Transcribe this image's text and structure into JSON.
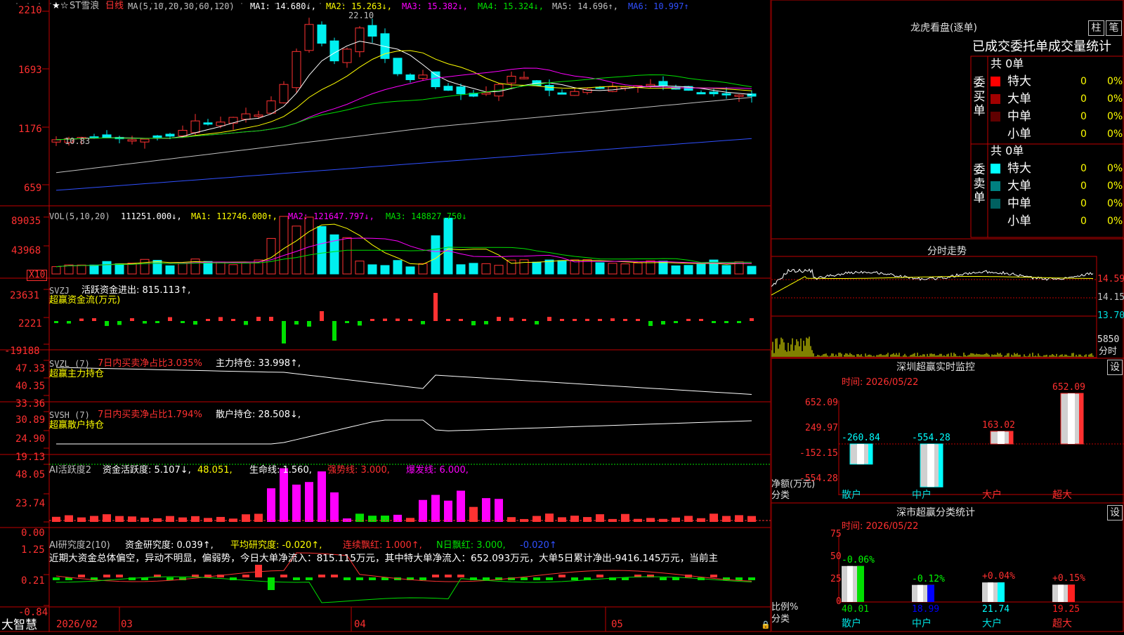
{
  "colors": {
    "up": "#ff3232",
    "down": "#00f0f0",
    "ma1": "#ffffff",
    "ma2": "#ffff00",
    "ma3": "#ff00ff",
    "ma4": "#00e000",
    "ma5": "#c0c0c0",
    "ma6": "#3050ff",
    "frame": "#c00000",
    "label": "#ff4040",
    "text": "#c0c0c0"
  },
  "panels": {
    "kline": {
      "star_icon": "★",
      "star_icon2": "☆",
      "stock_name": "ST雪浪",
      "period": "日线",
      "ma_params": "MA(5,10,20,30,60,120)",
      "ma1_text": "MA1: 14.680↓,",
      "ma2_text": "MA2: 15.263↓,",
      "ma3_text": "MA3: 15.382↓,",
      "ma4_text": "MA4: 15.324↓,",
      "ma5_text": "MA5: 14.696↑,",
      "ma6_text": "MA6: 10.997↑",
      "y_ticks": [
        "2210",
        "1693",
        "1176",
        "659"
      ],
      "high_marker": "22.10",
      "low_marker": "10.83",
      "price_top": 22.4,
      "price_bottom": 5.8
    },
    "vol": {
      "title": "VOL(5,10,20)",
      "value": "111251.000↓,",
      "ma1": "MA1: 112746.000↑,",
      "ma2": "MA2: 121647.797↓,",
      "ma3": "MA3: 148827.750↓",
      "y_ticks": [
        "89035",
        "43968"
      ],
      "unit": "X10"
    },
    "svzj": {
      "title": "SVZJ",
      "line1": "活跃资金进出: 815.113↑,",
      "line2": "超赢资金流(万元)",
      "y_ticks": [
        "23631",
        "2221",
        "-19188"
      ]
    },
    "svzl": {
      "title": "SVZL (7)",
      "part1": "7日内买卖净占比3.035%",
      "part2": "主力持仓: 33.998↑,",
      "line2": "超赢主力持仓",
      "y_ticks": [
        "47.33",
        "40.35",
        "33.36"
      ]
    },
    "svsh": {
      "title": "SVSH (7)",
      "part1": "7日内买卖净占比1.794%",
      "part2": "散户持仓: 28.508↓,",
      "line2": "超赢散户持仓",
      "y_ticks": [
        "30.89",
        "24.90",
        "19.13"
      ]
    },
    "ai1": {
      "title": "AI活跃度2",
      "t1": "资金活跃度: 5.107↓,",
      "t2": "48.051,",
      "t3": "生命线: 1.560,",
      "t4": "强势线: 3.000,",
      "t5": "爆发线: 6.000,",
      "y_ticks": [
        "48.05",
        "23.74",
        "0.00"
      ]
    },
    "ai2": {
      "title": "AI研究度2(10)",
      "t1": "资金研究度: 0.039↑,",
      "t2": "平均研究度: -0.020↑,",
      "t3": "连续飘红: 1.000↑,",
      "t4": "N日飘红: 3.000,",
      "t5": "-0.020↑",
      "commentary": "近期大资金总体偏空，异动不明显，偏弱势，今日大单净流入：815.115万元，其中特大单净流入：652.093万元，大单5日累计净出-9416.145万元，当前主",
      "y_ticks": [
        "1.25",
        "0.21",
        "-0.84"
      ]
    }
  },
  "xaxis": {
    "brand": "大智慧",
    "labels": [
      "2026/02",
      "03",
      "04",
      "05"
    ]
  },
  "side": {
    "dragon_title": "龙虎看盘(逐单)",
    "btn_bar": "柱",
    "btn_stroke": "笔",
    "order_header": "已成交委托单成交量统计",
    "buy": {
      "label": "委买单",
      "total": "共 0单",
      "rows": [
        {
          "name": "特大",
          "count": "0",
          "pct": "0%",
          "color": "#ff0000"
        },
        {
          "name": "大单",
          "count": "0",
          "pct": "0%",
          "color": "#a00000"
        },
        {
          "name": "中单",
          "count": "0",
          "pct": "0%",
          "color": "#600000"
        },
        {
          "name": "小单",
          "count": "0",
          "pct": "0%",
          "color": "#000000"
        }
      ]
    },
    "sell": {
      "label": "委卖单",
      "total": "共 0单",
      "rows": [
        {
          "name": "特大",
          "count": "0",
          "pct": "0%",
          "color": "#00ffff"
        },
        {
          "name": "大单",
          "count": "0",
          "pct": "0%",
          "color": "#008080"
        },
        {
          "name": "中单",
          "count": "0",
          "pct": "0%",
          "color": "#006060"
        },
        {
          "name": "小单",
          "count": "0",
          "pct": "0%",
          "color": "#000000"
        }
      ]
    },
    "intraday": {
      "title": "分时走势",
      "prices": [
        "14.59",
        "14.15",
        "13.70"
      ],
      "vol": "5850",
      "vol_label": "分时"
    },
    "sz_monitor": {
      "title": "深圳超赢实时监控",
      "setting": "设",
      "time": "时间: 2026/05/22",
      "y_ticks": [
        "652.09",
        "249.97",
        "-152.15",
        "-554.28"
      ],
      "ylabel1": "净额(万元)",
      "ylabel2": "分类",
      "categories": [
        "散户",
        "中户",
        "大户",
        "超大"
      ],
      "values": [
        -260.84,
        -554.28,
        163.02,
        652.09
      ],
      "value_labels": [
        "-260.84",
        "-554.28",
        "163.02",
        "652.09"
      ]
    },
    "sz_class": {
      "title": "深市超赢分类统计",
      "setting": "设",
      "time": "时间: 2026/05/22",
      "y_ticks": [
        "75",
        "50",
        "25",
        "0"
      ],
      "ylabel1": "比例%",
      "ylabel2": "分类",
      "categories": [
        "散户",
        "中户",
        "大户",
        "超大"
      ],
      "values": [
        40.01,
        18.99,
        21.74,
        19.25
      ],
      "value_labels": [
        "40.01",
        "18.99",
        "21.74",
        "19.25"
      ],
      "changes": [
        "-0.06%",
        "-0.12%",
        "+0.04%",
        "+0.15%"
      ]
    }
  }
}
